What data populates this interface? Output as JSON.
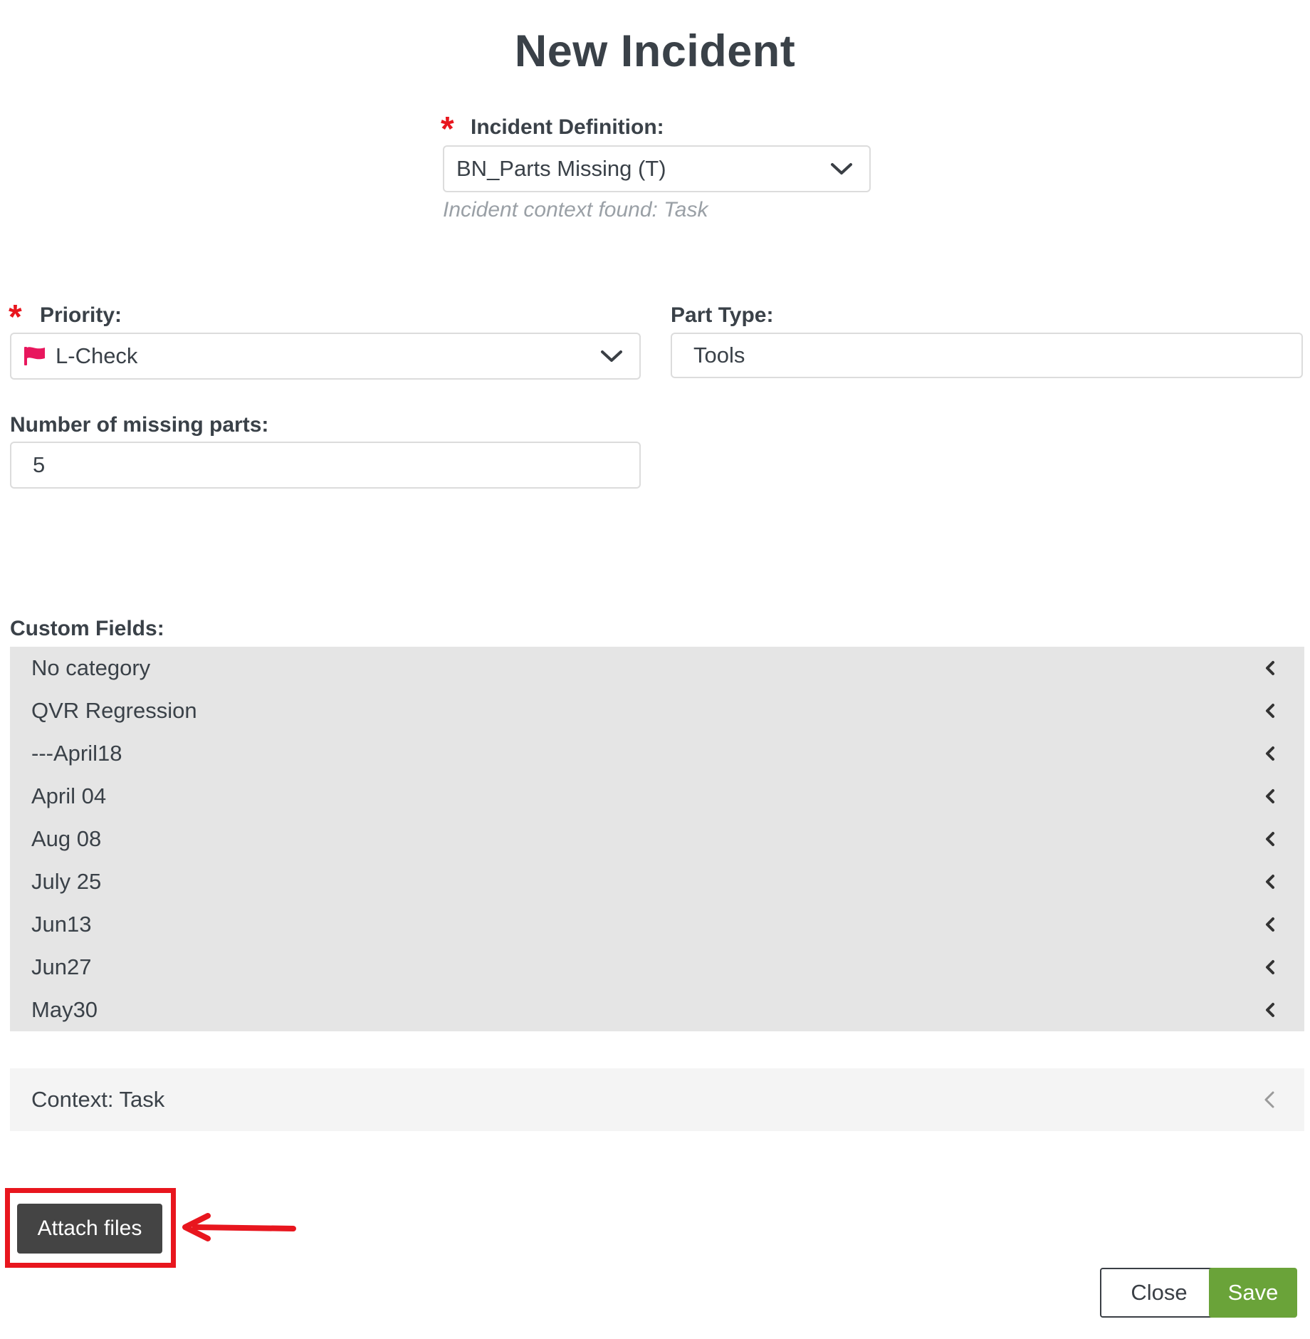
{
  "dialog": {
    "title": "New Incident"
  },
  "incident_definition": {
    "label": "Incident Definition:",
    "required_mark": "*",
    "value": "BN_Parts Missing (T)",
    "hint": "Incident context found: Task"
  },
  "priority": {
    "label": "Priority:",
    "required_mark": "*",
    "value": "L-Check",
    "flag_color": "#e8175d"
  },
  "part_type": {
    "label": "Part Type:",
    "value": "Tools"
  },
  "missing_parts": {
    "label": "Number of missing parts:",
    "value": "5"
  },
  "custom_fields": {
    "label": "Custom Fields:",
    "categories": [
      "No category",
      "QVR Regression",
      "---April18",
      "April 04",
      "Aug 08",
      "July 25",
      "Jun13",
      "Jun27",
      "May30"
    ]
  },
  "context": {
    "label": "Context: Task"
  },
  "buttons": {
    "attach": "Attach files",
    "close": "Close",
    "save": "Save"
  },
  "colors": {
    "required": "#e8161e",
    "save_green": "#6aa339",
    "attach_dark": "#444444",
    "annotation_red": "#e8161e"
  }
}
